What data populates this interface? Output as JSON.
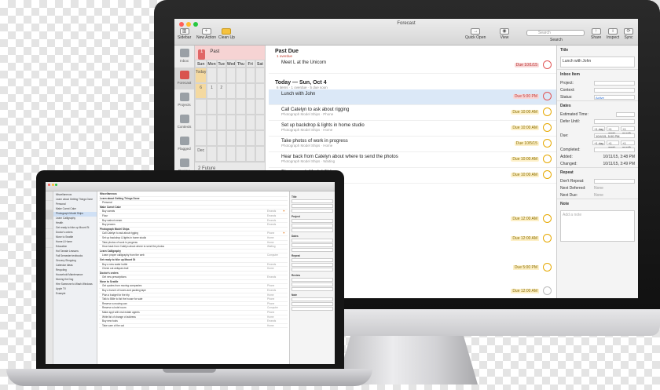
{
  "imac": {
    "window_title": "Forecast",
    "toolbar": {
      "sidebar": "Sidebar",
      "new_action": "New Action",
      "clean_up": "Clean Up",
      "quick_open": "Quick Open",
      "view": "View",
      "search_placeholder": "Search",
      "search_label": "Search",
      "share": "Share",
      "inspect": "Inspect",
      "sync": "Sync"
    },
    "perspectives": [
      "Inbox",
      "Forecast",
      "Projects",
      "Contexts",
      "Flagged",
      "Review"
    ],
    "calendar": {
      "past_label": "Past",
      "past_count": "1",
      "weekday_headers": [
        "Sun",
        "Mon",
        "Tue",
        "Wed",
        "Thu",
        "Fri",
        "Sat"
      ],
      "today_row": [
        "Today",
        "",
        "",
        "",
        "",
        "",
        ""
      ],
      "rows": [
        [
          "6",
          "1",
          "2",
          "",
          "",
          "",
          ""
        ],
        [
          "",
          "",
          "",
          "",
          "",
          "",
          ""
        ],
        [
          "",
          "",
          "",
          "",
          "",
          "",
          ""
        ],
        [
          "",
          "",
          "",
          "",
          "",
          "",
          ""
        ],
        [
          "Dec",
          "",
          "",
          "",
          "",
          "",
          ""
        ]
      ],
      "future_count": "2",
      "future_label": "Future"
    },
    "outline": {
      "past_due_header": "Past Due",
      "past_due_sub": "1 overdue",
      "past_due_tasks": [
        {
          "title": "Meet L at the Unicorn",
          "meta": "",
          "due": "Due 10/1/15"
        }
      ],
      "today_header": "Today — Sun, Oct 4",
      "today_sub": "6 items · 1 overdue · 5 due soon",
      "today_tasks": [
        {
          "title": "Lunch with John",
          "meta": "",
          "due": "Due 5:00 PM"
        },
        {
          "title": "Call Catelyn to ask about rigging",
          "meta": "Photograph Model Ships · Phone",
          "due": "Due 10:00 AM"
        },
        {
          "title": "Set up backdrop & lights in home studio",
          "meta": "Photograph Model Ships · Home",
          "due": "Due 10:00 AM"
        },
        {
          "title": "Take photos of work in progress",
          "meta": "Photograph Model Ships · Home",
          "due": "Due 10/5/15"
        },
        {
          "title": "Hear back from Catelyn about where to send the photos",
          "meta": "Photograph Model Ships · Waiting",
          "due": "Due 10:00 AM"
        },
        {
          "title": "Photograph Model Ships",
          "meta": "Personal",
          "due": "Due 10:00 AM"
        }
      ],
      "lower_dues": [
        "Due 12:00 AM",
        "Due 12:00 AM",
        "Due 5:00 PM",
        "Due 12:00 AM"
      ]
    },
    "inspector": {
      "title_header": "Title",
      "title_value": "Lunch with John",
      "inbox_header": "Inbox Item",
      "project_label": "Project:",
      "context_label": "Context:",
      "status_label": "Status:",
      "status_value": "Active",
      "dates_header": "Dates",
      "estimated_label": "Estimated Time:",
      "defer_label": "Defer Until:",
      "due_label": "Due:",
      "due_value": "10/4/15, 5:00 PM",
      "quick_1": "+1 day",
      "quick_2": "+1 week",
      "quick_3": "+1 month",
      "completed_label": "Completed:",
      "added_label": "Added:",
      "added_value": "10/11/15, 3:48 PM",
      "changed_label": "Changed:",
      "changed_value": "10/11/15, 3:49 PM",
      "repeat_header": "Repeat",
      "dont_repeat_label": "Don't Repeat:",
      "next_deferred_label": "Next Deferred:",
      "next_due_label": "Next Due:",
      "none_value": "None",
      "note_header": "Note",
      "note_placeholder": "Add a note"
    }
  },
  "macbook": {
    "window_title": "",
    "sidebar_items": [
      "Miscellaneous",
      "Learn about Getting Things Done",
      "Personal",
      "Make Carrot Cake",
      "Photograph Model Ships",
      "Learn Calligraphy",
      "Health",
      "Get ready to hike up Mount St",
      "Doctor's orders",
      "Move to Seattle",
      "Home & Home",
      "Education",
      "Hot Tamale Lessons",
      "Fall Semester textbooks",
      "Grocery Shopping",
      "Calendar Ideas",
      "Recycling",
      "Household Maintenance",
      "Moving the Dog",
      "Hire Someone to Wash Windows",
      "Apple TV",
      "Example"
    ],
    "outline_rows": [
      {
        "text": "Miscellaneous",
        "group": true,
        "ctx": "",
        "flag": ""
      },
      {
        "text": "Learn about Getting Things Done",
        "group": true,
        "ctx": "",
        "flag": ""
      },
      {
        "text": "Personal",
        "group": false,
        "ctx": "",
        "flag": ""
      },
      {
        "text": "Make Carrot Cake",
        "group": true,
        "ctx": "",
        "flag": ""
      },
      {
        "text": "Buy carrots",
        "group": false,
        "ctx": "Errands",
        "flag": "⚑"
      },
      {
        "text": "Flour",
        "group": false,
        "ctx": "Errands",
        "flag": ""
      },
      {
        "text": "Buy walnut cream",
        "group": false,
        "ctx": "Errands",
        "flag": ""
      },
      {
        "text": "Buy pecans",
        "group": false,
        "ctx": "Errands",
        "flag": ""
      },
      {
        "text": "Photograph Model Ships",
        "group": true,
        "ctx": "",
        "flag": ""
      },
      {
        "text": "Call Catelyn to ask about rigging",
        "group": false,
        "ctx": "Phone",
        "flag": "⚑"
      },
      {
        "text": "Set up backdrop & lights in home studio",
        "group": false,
        "ctx": "Home",
        "flag": ""
      },
      {
        "text": "Take photos of work in progress",
        "group": false,
        "ctx": "Home",
        "flag": ""
      },
      {
        "text": "Hear back from Catelyn about where to send the photos",
        "group": false,
        "ctx": "Waiting",
        "flag": ""
      },
      {
        "text": "Learn Calligraphy",
        "group": true,
        "ctx": "",
        "flag": ""
      },
      {
        "text": "Learn proper calligraphy from the web",
        "group": false,
        "ctx": "Computer",
        "flag": ""
      },
      {
        "text": "Get ready to hike up Mount St",
        "group": true,
        "ctx": "",
        "flag": ""
      },
      {
        "text": "Buy a new water bottle",
        "group": false,
        "ctx": "Errands",
        "flag": ""
      },
      {
        "text": "Check out antiques trail",
        "group": false,
        "ctx": "Home",
        "flag": ""
      },
      {
        "text": "Doctor's orders",
        "group": true,
        "ctx": "",
        "flag": ""
      },
      {
        "text": "Get new prescriptions",
        "group": false,
        "ctx": "Errands",
        "flag": ""
      },
      {
        "text": "Move to Seattle",
        "group": true,
        "ctx": "",
        "flag": ""
      },
      {
        "text": "Get quotes from moving companies",
        "group": false,
        "ctx": "Phone",
        "flag": ""
      },
      {
        "text": "Buy a bunch of boxes and packing tape",
        "group": false,
        "ctx": "Errands",
        "flag": ""
      },
      {
        "text": "Plan a budget for the trip",
        "group": false,
        "ctx": "Home",
        "flag": ""
      },
      {
        "text": "Talk to Billie to list the house for sale",
        "group": false,
        "ctx": "Phone",
        "flag": ""
      },
      {
        "text": "Reserve a moving van",
        "group": false,
        "ctx": "Phone",
        "flag": ""
      },
      {
        "text": "Reserve a hotel room",
        "group": false,
        "ctx": "Computer",
        "flag": ""
      },
      {
        "text": "Make appt with real estate agents",
        "group": false,
        "ctx": "Phone",
        "flag": ""
      },
      {
        "text": "Write list of change of address",
        "group": false,
        "ctx": "Home",
        "flag": ""
      },
      {
        "text": "Buy new tools",
        "group": false,
        "ctx": "Errands",
        "flag": ""
      },
      {
        "text": "Take care of the cat",
        "group": false,
        "ctx": "Home",
        "flag": ""
      }
    ],
    "inspector_headers": [
      "Title",
      "Project",
      "Dates",
      "Repeat",
      "Review",
      "Note"
    ]
  },
  "colors": {
    "overdue_red": "#e05555",
    "due_soon_amber": "#e6a800",
    "selection_blue": "#dbe8f7"
  }
}
